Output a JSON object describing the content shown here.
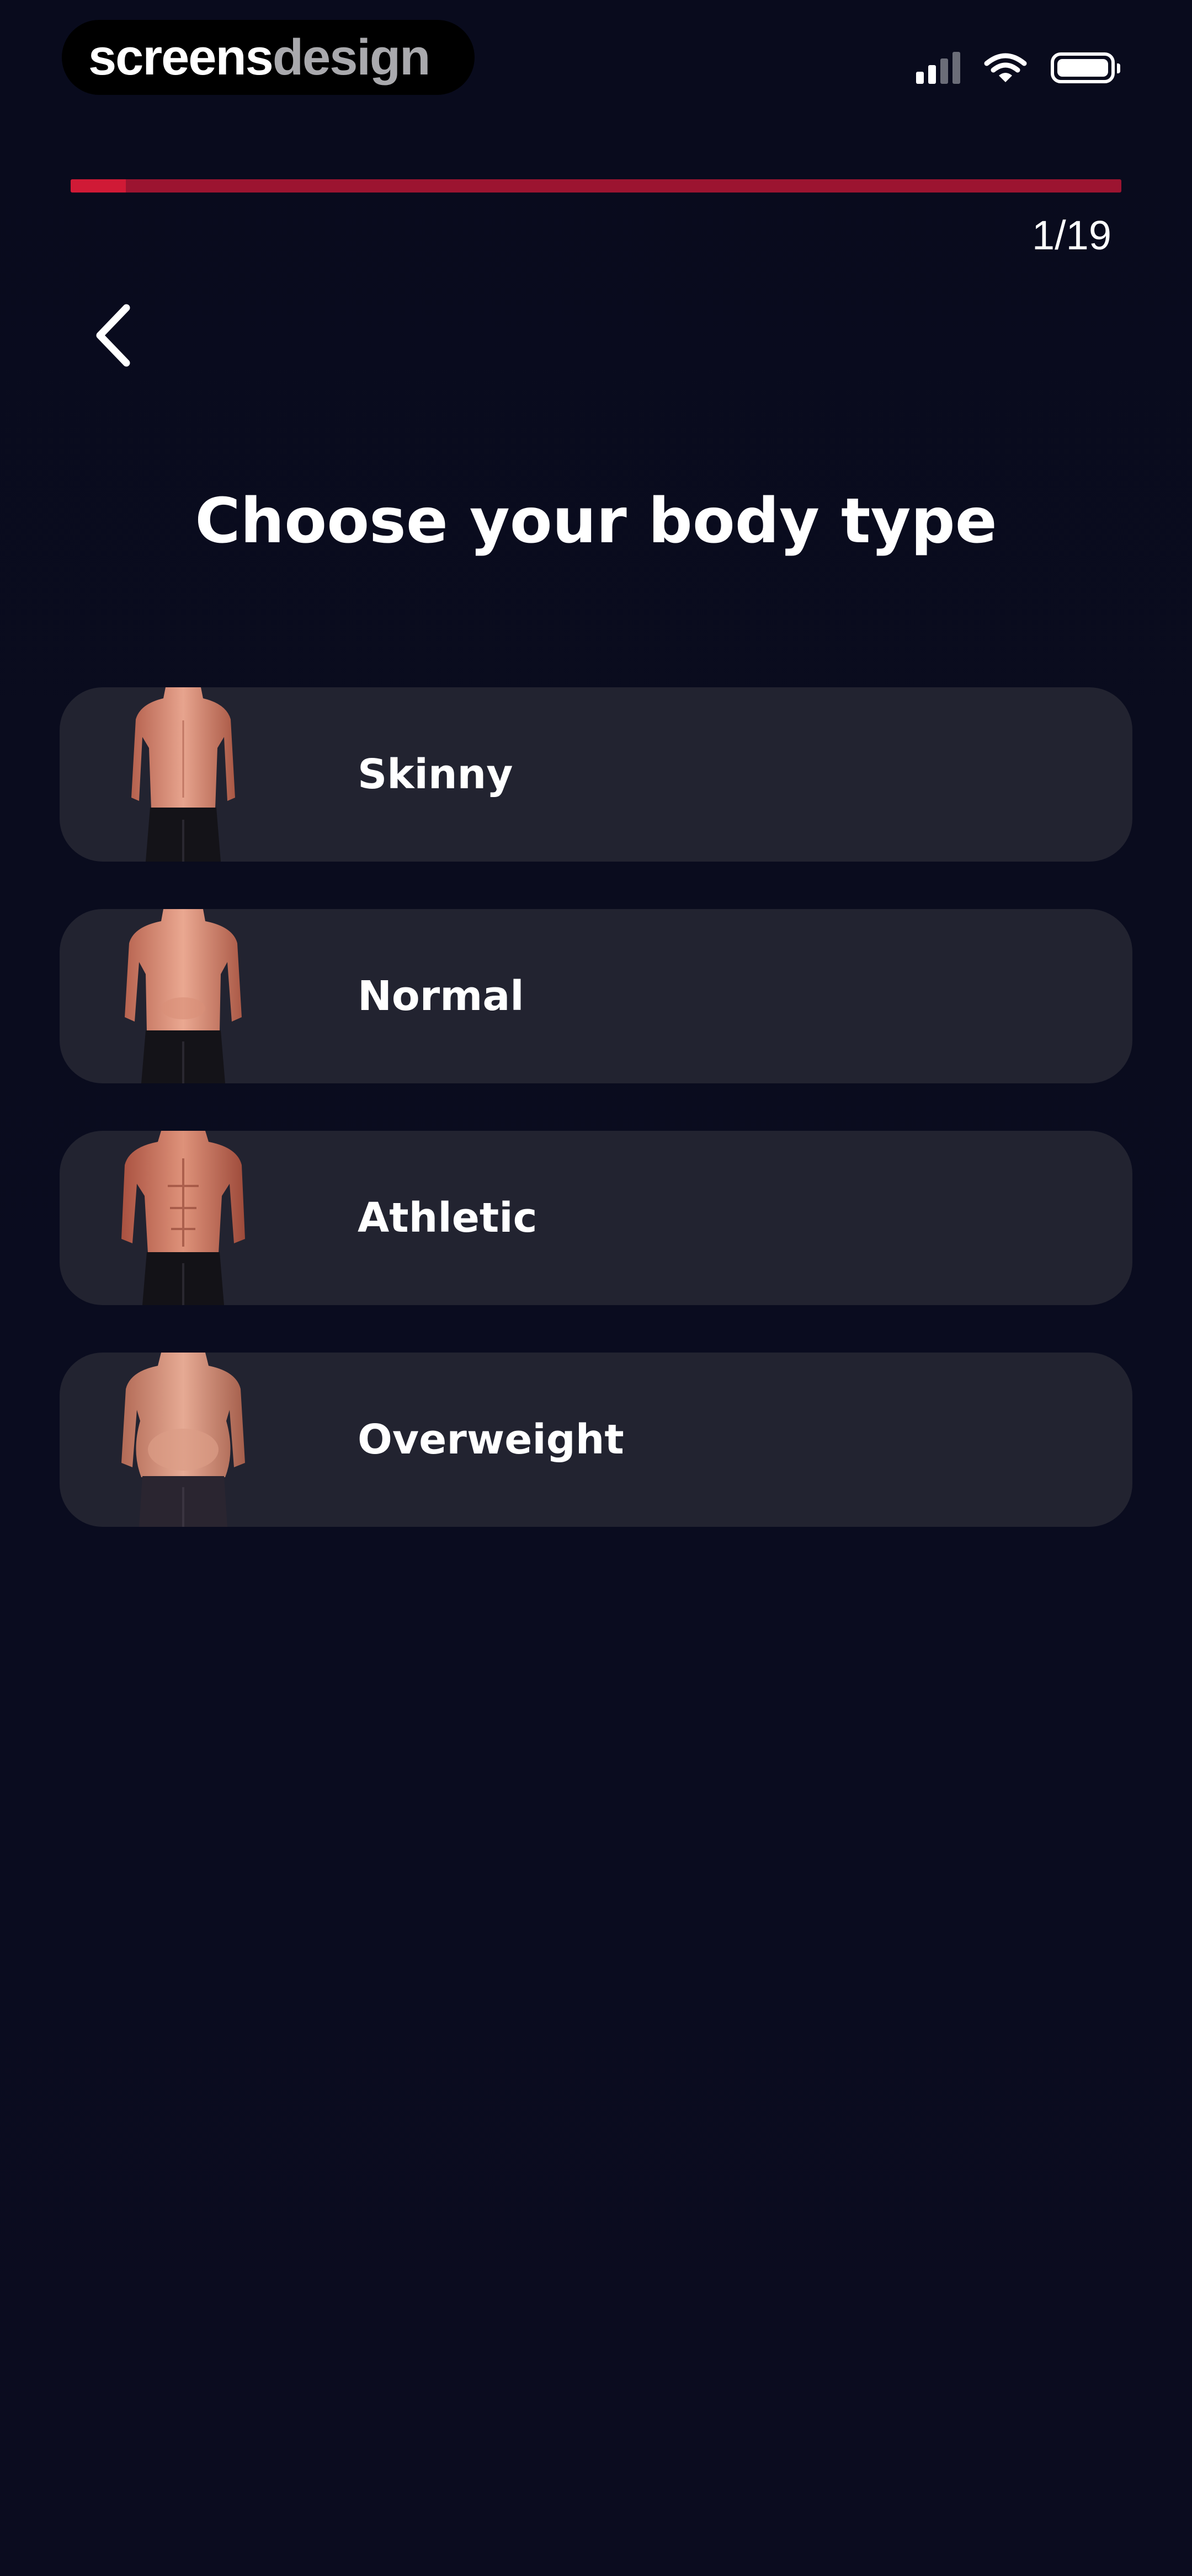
{
  "status_bar": {
    "brand_part1": "screens",
    "brand_part2": "design",
    "signal_icon": "cellular-signal-icon",
    "wifi_icon": "wifi-icon",
    "battery_icon": "battery-icon"
  },
  "progress": {
    "current": 1,
    "total": 19,
    "label": "1/19",
    "fill_fraction": 0.0526,
    "color": "#d01a36"
  },
  "header": {
    "back_icon": "chevron-left-icon",
    "title": "Choose your body type"
  },
  "options": [
    {
      "label": "Skinny",
      "image": "skinny-torso-image"
    },
    {
      "label": "Normal",
      "image": "normal-torso-image"
    },
    {
      "label": "Athletic",
      "image": "athletic-torso-image"
    },
    {
      "label": "Overweight",
      "image": "overweight-torso-image"
    }
  ],
  "colors": {
    "background": "#0a0c1e",
    "card": "#222330",
    "accent": "#d01a36",
    "text": "#ffffff"
  }
}
